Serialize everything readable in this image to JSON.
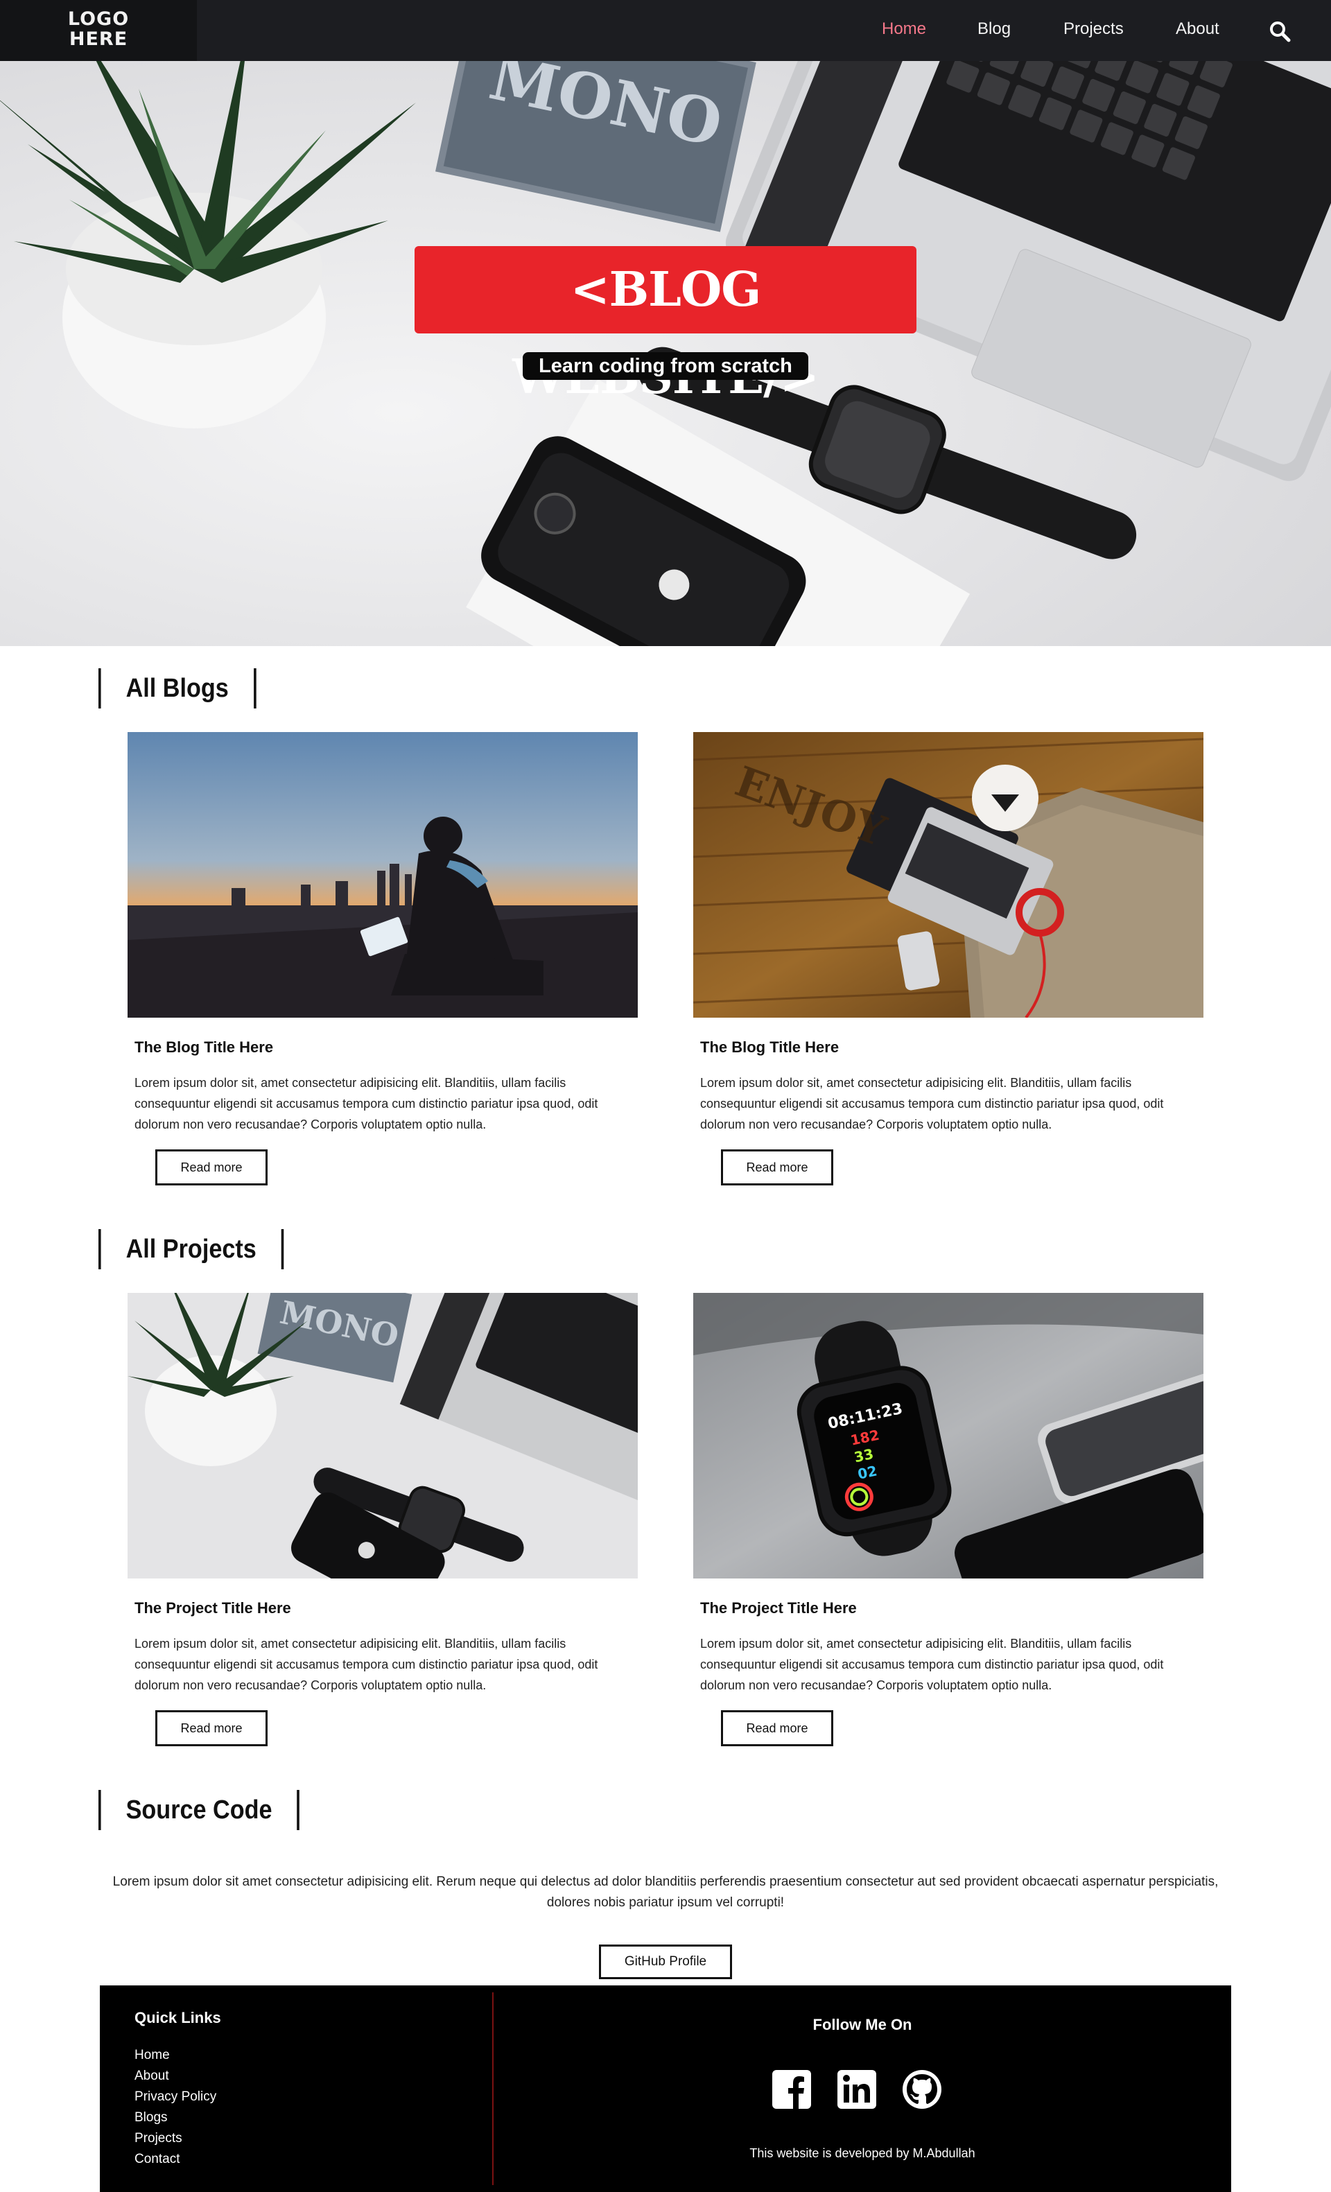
{
  "nav": {
    "logo_line1": "LOGO",
    "logo_line2": "HERE",
    "links": [
      "Home",
      "Blog",
      "Projects",
      "About"
    ],
    "active": "Home",
    "search_icon": "search-icon",
    "active_color": "#f5788a",
    "background": "#1c1d21"
  },
  "hero": {
    "title": "<BLOG WEBSITE/>",
    "subtitle": "Learn coding from scratch",
    "title_bg": "#e8242a"
  },
  "blogs": {
    "heading": "All Blogs",
    "items": [
      {
        "title": "The Blog Title Here",
        "text": "Lorem ipsum dolor sit, amet consectetur adipisicing elit. Blanditiis, ullam facilis consequuntur eligendi sit accusamus tempora cum distinctio pariatur ipsa quod, odit dolorum non vero recusandae? Corporis voluptatem optio nulla.",
        "button": "Read more"
      },
      {
        "title": "The Blog Title Here",
        "text": "Lorem ipsum dolor sit, amet consectetur adipisicing elit. Blanditiis, ullam facilis consequuntur eligendi sit accusamus tempora cum distinctio pariatur ipsa quod, odit dolorum non vero recusandae? Corporis voluptatem optio nulla.",
        "button": "Read more"
      }
    ]
  },
  "projects": {
    "heading": "All Projects",
    "items": [
      {
        "title": "The Project Title Here",
        "text": "Lorem ipsum dolor sit, amet consectetur adipisicing elit. Blanditiis, ullam facilis consequuntur eligendi sit accusamus tempora cum distinctio pariatur ipsa quod, odit dolorum non vero recusandae? Corporis voluptatem optio nulla.",
        "button": "Read more"
      },
      {
        "title": "The Project Title Here",
        "text": "Lorem ipsum dolor sit, amet consectetur adipisicing elit. Blanditiis, ullam facilis consequuntur eligendi sit accusamus tempora cum distinctio pariatur ipsa quod, odit dolorum non vero recusandae? Corporis voluptatem optio nulla.",
        "button": "Read more"
      }
    ]
  },
  "source": {
    "heading": "Source Code",
    "text": "Lorem ipsum dolor sit amet consectetur adipisicing elit. Rerum neque qui delectus ad dolor blanditiis perferendis praesentium consectetur aut sed provident obcaecati aspernatur perspiciatis, dolores nobis pariatur ipsum vel corrupti!",
    "button": "GitHub Profile"
  },
  "footer": {
    "quick_links_title": "Quick Links",
    "quick_links": [
      "Home",
      "About",
      "Privacy Policy",
      "Blogs",
      "Projects",
      "Contact"
    ],
    "follow_title": "Follow Me On",
    "social_icons": [
      "facebook-icon",
      "linkedin-icon",
      "github-icon"
    ],
    "developed_by": "This website is developed by M.Abdullah",
    "divider_color": "#7a1212"
  },
  "watch_readout": {
    "time": "08:11:23",
    "stats": [
      "182",
      "33",
      "02"
    ]
  }
}
